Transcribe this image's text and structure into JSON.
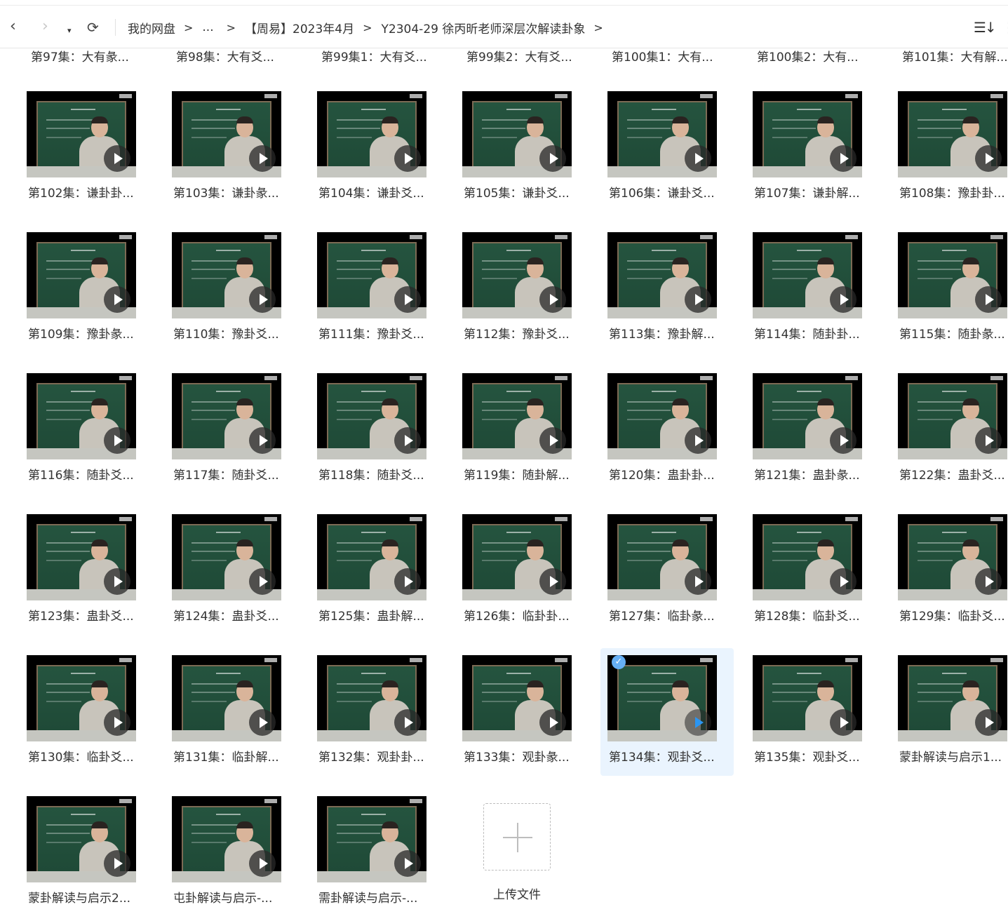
{
  "nav": {
    "back": "‹",
    "forward": "›",
    "history": "▾",
    "refresh": "⟳"
  },
  "breadcrumb": [
    "我的网盘",
    "...",
    "【周易】2023年4月",
    "Y2304-29 徐丙昕老师深层次解读卦象"
  ],
  "breadcrumb_separator": ">",
  "toolbar_icons": {
    "sort": "☰↓",
    "more": "⋮"
  },
  "top_partial_row": [
    "第97集：大有彖...",
    "第98集：大有爻...",
    "第99集1：大有爻...",
    "第99集2：大有爻...",
    "第100集1：大有...",
    "第100集2：大有...",
    "第101集：大有解..."
  ],
  "videos": [
    "第102集：谦卦卦...",
    "第103集：谦卦彖...",
    "第104集：谦卦爻...",
    "第105集：谦卦爻...",
    "第106集：谦卦爻...",
    "第107集：谦卦解...",
    "第108集：豫卦卦...",
    "第109集：豫卦彖...",
    "第110集：豫卦爻...",
    "第111集：豫卦爻...",
    "第112集：豫卦爻...",
    "第113集：豫卦解...",
    "第114集：随卦卦...",
    "第115集：随卦彖...",
    "第116集：随卦爻...",
    "第117集：随卦爻...",
    "第118集：随卦爻...",
    "第119集：随卦解...",
    "第120集：蛊卦卦...",
    "第121集：蛊卦彖...",
    "第122集：蛊卦爻...",
    "第123集：蛊卦爻...",
    "第124集：蛊卦爻...",
    "第125集：蛊卦解...",
    "第126集：临卦卦...",
    "第127集：临卦彖...",
    "第128集：临卦爻...",
    "第129集：临卦爻...",
    "第130集：临卦爻...",
    "第131集：临卦解...",
    "第132集：观卦卦...",
    "第133集：观卦彖...",
    "第134集：观卦爻...",
    "第135集：观卦爻...",
    "蒙卦解读与启示1...",
    "蒙卦解读与启示2...",
    "屯卦解读与启示-...",
    "需卦解读与启示-..."
  ],
  "selected_index": 32,
  "selected_check": "✓",
  "upload": {
    "label": "上传文件"
  },
  "colors": {
    "selected_bg": "#eaf4fe",
    "accent": "#2b95f2"
  }
}
